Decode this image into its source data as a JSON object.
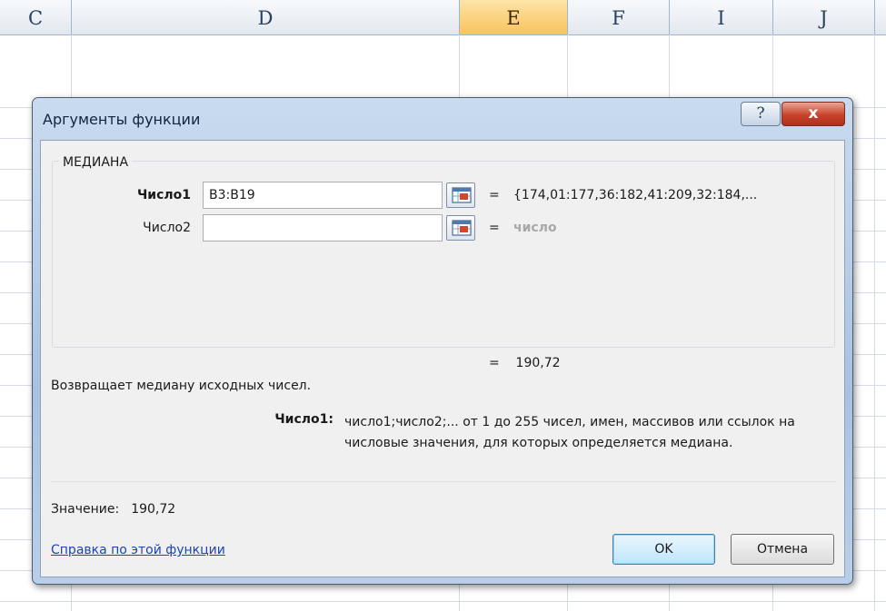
{
  "spreadsheet": {
    "columns": [
      {
        "label": "C",
        "active": false
      },
      {
        "label": "D",
        "active": false
      },
      {
        "label": "E",
        "active": true
      },
      {
        "label": "F",
        "active": false
      },
      {
        "label": "I",
        "active": false
      },
      {
        "label": "J",
        "active": false
      }
    ]
  },
  "dialog": {
    "title": "Аргументы функции",
    "help_button": "?",
    "close_button": "x",
    "function_name": "МЕДИАНА",
    "args": [
      {
        "label": "Число1",
        "value": "B3:B19",
        "placeholder": "",
        "result": "{174,01:177,36:182,41:209,32:184,..."
      },
      {
        "label": "Число2",
        "value": "",
        "placeholder": "",
        "result": "число"
      }
    ],
    "equals_sign": "=",
    "formula_result": "190,72",
    "description": "Возвращает медиану исходных чисел.",
    "param_help": {
      "name": "Число1:",
      "text": "число1;число2;... от 1 до 255 чисел, имен, массивов или ссылок на числовые значения, для которых определяется медиана."
    },
    "value_label": "Значение:",
    "value": "190,72",
    "help_link": "Справка по этой функции",
    "ok_label": "OK",
    "cancel_label": "Отмена"
  }
}
